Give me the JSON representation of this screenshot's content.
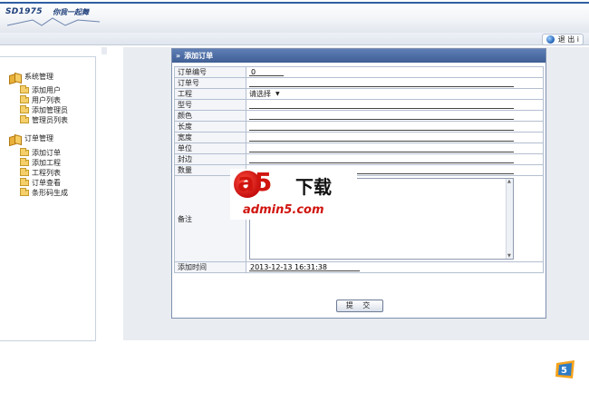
{
  "header": {
    "logo_word": "SD1975",
    "slogan": "你我一起舞",
    "logout_label": "退 出 i"
  },
  "sidebar": {
    "groups": [
      {
        "label": "系统管理",
        "items": [
          "添加用户",
          "用户列表",
          "添加管理员",
          "管理员列表"
        ]
      },
      {
        "label": "订单管理",
        "items": [
          "添加订单",
          "添加工程",
          "工程列表",
          "订单查看",
          "条形码生成"
        ]
      }
    ]
  },
  "panel": {
    "title": "添加订单",
    "fields": [
      {
        "label": "订单编号",
        "value": "0"
      },
      {
        "label": "订单号",
        "value": ""
      },
      {
        "label": "工程",
        "value": "请选择"
      },
      {
        "label": "型号",
        "value": ""
      },
      {
        "label": "颜色",
        "value": ""
      },
      {
        "label": "长度",
        "value": ""
      },
      {
        "label": "宽度",
        "value": ""
      },
      {
        "label": "单位",
        "value": ""
      },
      {
        "label": "封边",
        "value": ""
      },
      {
        "label": "数量",
        "value": ""
      }
    ],
    "remarks_label": "备注",
    "time_label": "添加时间",
    "time_value": "2013-12-13 16:31:38",
    "submit_label": "提 交"
  },
  "watermark": {
    "big": "a5",
    "text": "下载",
    "domain": "admin5.com"
  }
}
